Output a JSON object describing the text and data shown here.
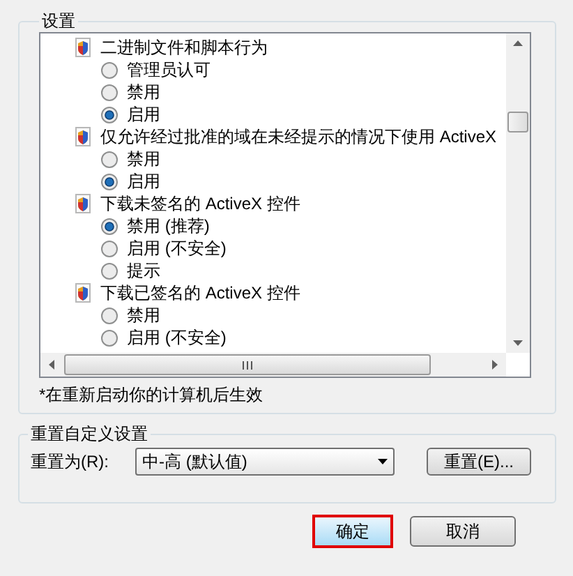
{
  "settings_group": {
    "title": "设置",
    "items": [
      {
        "label": "二进制文件和脚本行为",
        "children": [
          {
            "label": "管理员认可",
            "selected": false
          },
          {
            "label": "禁用",
            "selected": false
          },
          {
            "label": "启用",
            "selected": true
          }
        ]
      },
      {
        "label": "仅允许经过批准的域在未经提示的情况下使用 ActiveX",
        "children": [
          {
            "label": "禁用",
            "selected": false
          },
          {
            "label": "启用",
            "selected": true
          }
        ]
      },
      {
        "label": "下载未签名的 ActiveX 控件",
        "children": [
          {
            "label": "禁用 (推荐)",
            "selected": true
          },
          {
            "label": "启用 (不安全)",
            "selected": false
          },
          {
            "label": "提示",
            "selected": false
          }
        ]
      },
      {
        "label": "下载已签名的 ActiveX 控件",
        "children": [
          {
            "label": "禁用",
            "selected": false
          },
          {
            "label": "启用 (不安全)",
            "selected": false
          }
        ]
      }
    ],
    "note": "*在重新启动你的计算机后生效"
  },
  "reset_group": {
    "title": "重置自定义设置",
    "label": "重置为(R):",
    "dropdown_value": "中-高 (默认值)",
    "button": "重置(E)..."
  },
  "buttons": [
    {
      "label": "确定",
      "highlighted": true
    },
    {
      "label": "取消",
      "highlighted": false
    }
  ]
}
